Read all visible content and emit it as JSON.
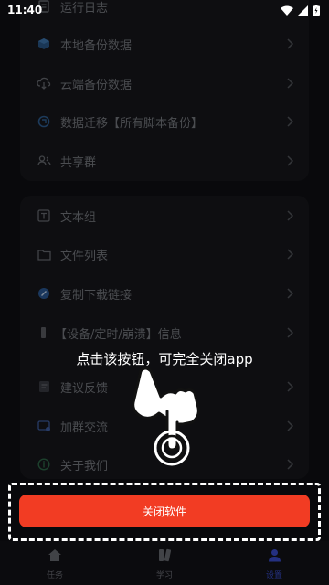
{
  "status_bar": {
    "time": "11:40"
  },
  "menu": {
    "card1": [
      {
        "label": "运行日志",
        "icon": "log-icon"
      },
      {
        "label": "本地备份数据",
        "icon": "cube-icon"
      },
      {
        "label": "云端备份数据",
        "icon": "cloud-download-icon"
      },
      {
        "label": "数据迁移【所有脚本备份】",
        "icon": "migrate-icon"
      },
      {
        "label": "共享群",
        "icon": "group-icon"
      }
    ],
    "card2": [
      {
        "label": "文本组",
        "icon": "text-icon"
      },
      {
        "label": "文件列表",
        "icon": "folder-icon"
      },
      {
        "label": "复制下载链接",
        "icon": "link-icon"
      },
      {
        "label": "【设备/定时/崩溃】信息",
        "icon": "device-icon"
      },
      {
        "label": "建议反馈",
        "icon": "feedback-icon"
      },
      {
        "label": "加群交流",
        "icon": "chat-icon"
      },
      {
        "label": "关于我们",
        "icon": "info-icon"
      }
    ]
  },
  "guide": {
    "hint": "点击该按钮，可完全关闭app"
  },
  "close_button": {
    "label": "关闭软件"
  },
  "bottom_nav": [
    {
      "label": "任务",
      "icon": "home-icon",
      "active": false
    },
    {
      "label": "学习",
      "icon": "book-icon",
      "active": false
    },
    {
      "label": "设置",
      "icon": "user-icon",
      "active": true
    }
  ],
  "colors": {
    "accent": "#f23c23",
    "active_nav": "#3a4ed0",
    "background": "#0f1014"
  }
}
